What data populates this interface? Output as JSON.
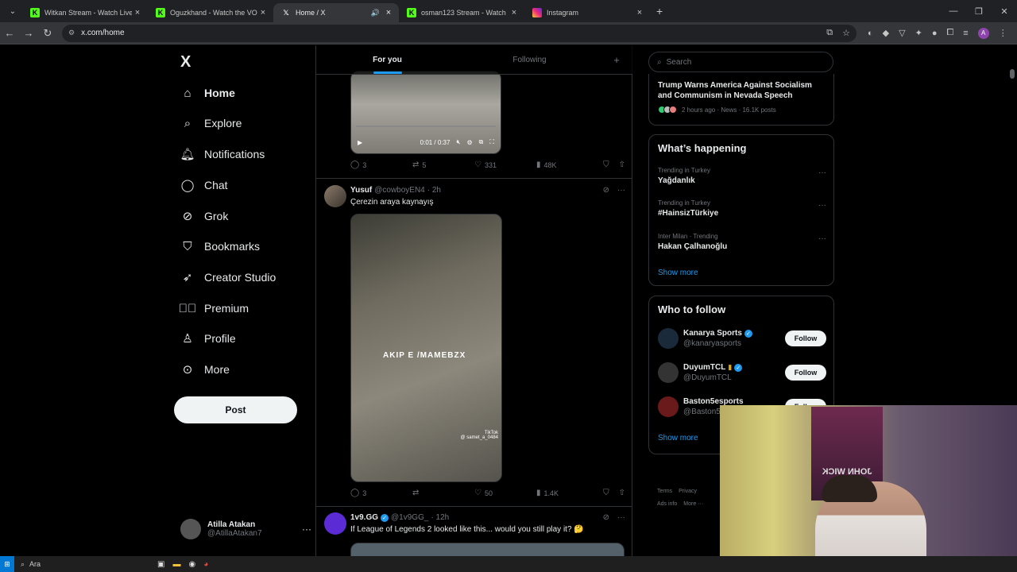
{
  "browser": {
    "tabs": [
      {
        "title": "Witkan Stream - Watch Live on",
        "favicon": "kick-icon"
      },
      {
        "title": "Oguzkhand - Watch the VOD o",
        "favicon": "kick-icon"
      },
      {
        "title": "Home / X",
        "favicon": "x-icon",
        "active": true
      },
      {
        "title": "osman123 Stream - Watch Live",
        "favicon": "kick-icon"
      },
      {
        "title": "Instagram",
        "favicon": "instagram-icon"
      }
    ],
    "url": "x.com/home"
  },
  "nav": {
    "logo": "X",
    "items": [
      {
        "label": "Home",
        "icon": "home-icon"
      },
      {
        "label": "Explore",
        "icon": "search-icon"
      },
      {
        "label": "Notifications",
        "icon": "bell-icon"
      },
      {
        "label": "Chat",
        "icon": "chat-icon"
      },
      {
        "label": "Grok",
        "icon": "grok-icon"
      },
      {
        "label": "Bookmarks",
        "icon": "bookmark-icon"
      },
      {
        "label": "Creator Studio",
        "icon": "rocket-icon"
      },
      {
        "label": "Premium",
        "icon": "premium-icon"
      },
      {
        "label": "Profile",
        "icon": "person-icon"
      },
      {
        "label": "More",
        "icon": "more-circle-icon"
      }
    ],
    "post_label": "Post",
    "account": {
      "name": "Atilla Atakan",
      "handle": "@AtillaAtakan7"
    }
  },
  "feed": {
    "tabs": [
      "For you",
      "Following"
    ],
    "video1": {
      "time": "0:01 / 0:37"
    },
    "tweet1_actions": {
      "replies": "3",
      "reposts": "5",
      "likes": "331",
      "views": "48K"
    },
    "tweet2": {
      "name": "Yusuf",
      "handle": "@cowboyEN4",
      "time": "· 2h",
      "text": "Çerezin araya kaynayış",
      "watermark": "AKIP E /MAMEBZX",
      "tiktok": "TikTok",
      "tiktok_user": "@ samet_a_0484",
      "replies": "3",
      "reposts": "",
      "likes": "50",
      "views": "1.4K"
    },
    "tweet3": {
      "name": "1v9.GG",
      "handle": "@1v9GG_",
      "time": "· 12h",
      "text": "If League of Legends 2 looked like this... would you still play it? 🤔"
    }
  },
  "sidebar": {
    "search_placeholder": "Search",
    "news": {
      "title": "Trump Warns America Against Socialism and Communism in Nevada Speech",
      "meta": "2 hours ago · News · 16.1K posts"
    },
    "whats_happening": {
      "title": "What’s happening",
      "trends": [
        {
          "category": "Trending in Turkey",
          "name": "Yağdanlık"
        },
        {
          "category": "Trending in Turkey",
          "name": "#HainsizTürkiye"
        },
        {
          "category": "Inter Milan · Trending",
          "name": "Hakan Çalhanoğlu"
        }
      ],
      "show_more": "Show more"
    },
    "who_to_follow": {
      "title": "Who to follow",
      "accounts": [
        {
          "name": "Kanarya Sports",
          "handle": "@kanaryasports",
          "follow": "Follow"
        },
        {
          "name": "DuyumTCL",
          "handle": "@DuyumTCL",
          "follow": "Follow"
        },
        {
          "name": "Baston5esports",
          "handle": "@Baston5",
          "follow": "Follow"
        }
      ],
      "show_more": "Show more"
    },
    "footer": [
      "Terms",
      "Privacy",
      "Ads info",
      "More ···"
    ]
  },
  "webcam": {
    "poster_text": "JOHN WICK"
  },
  "taskbar": {
    "search": "Ara"
  },
  "colors": {
    "accent": "#1d9bf0",
    "background": "#000000",
    "border": "#2f3336",
    "muted": "#71767b"
  }
}
